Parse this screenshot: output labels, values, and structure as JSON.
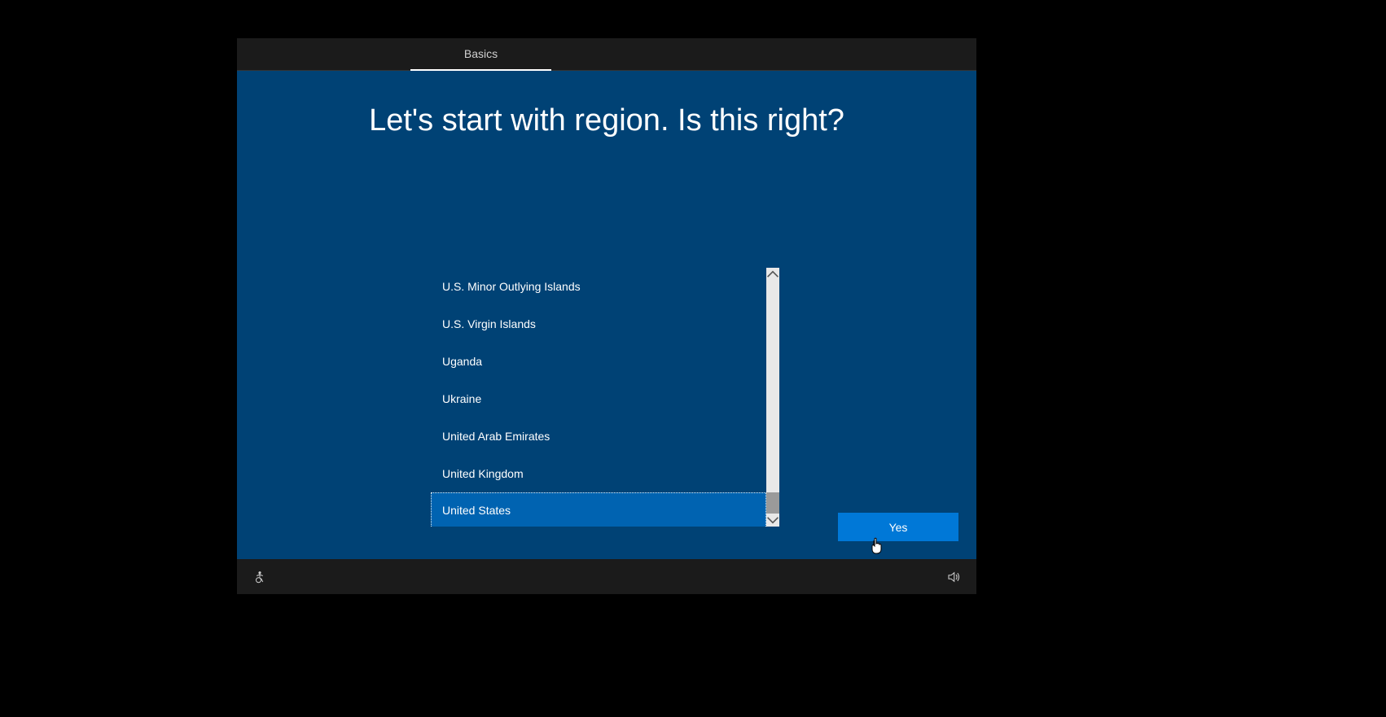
{
  "tabs": {
    "basics": "Basics"
  },
  "page": {
    "title": "Let's start with region. Is this right?",
    "yes_button": "Yes"
  },
  "region_list": {
    "items": [
      "U.S. Minor Outlying Islands",
      "U.S. Virgin Islands",
      "Uganda",
      "Ukraine",
      "United Arab Emirates",
      "United Kingdom",
      "United States"
    ],
    "selected_index": 6
  },
  "icons": {
    "accessibility": "accessibility-icon",
    "volume": "volume-icon"
  }
}
